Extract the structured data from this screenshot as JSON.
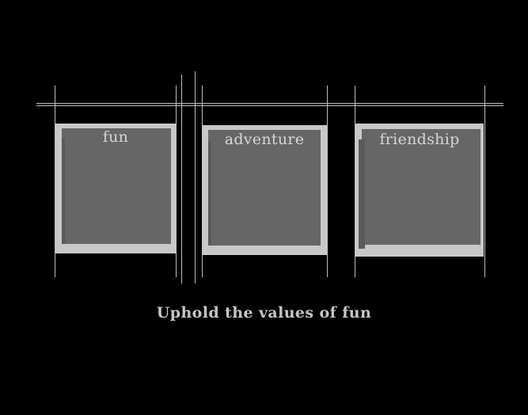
{
  "cards": [
    {
      "label": "fun"
    },
    {
      "label": "adventure"
    },
    {
      "label": "friendship"
    }
  ],
  "caption": "Uphold the values of fun",
  "colors": {
    "background": "#000000",
    "frame": "#c8c8c8",
    "panel": "#666666",
    "text": "#d6d6d6",
    "guide_lines": "#bdbdbd"
  }
}
